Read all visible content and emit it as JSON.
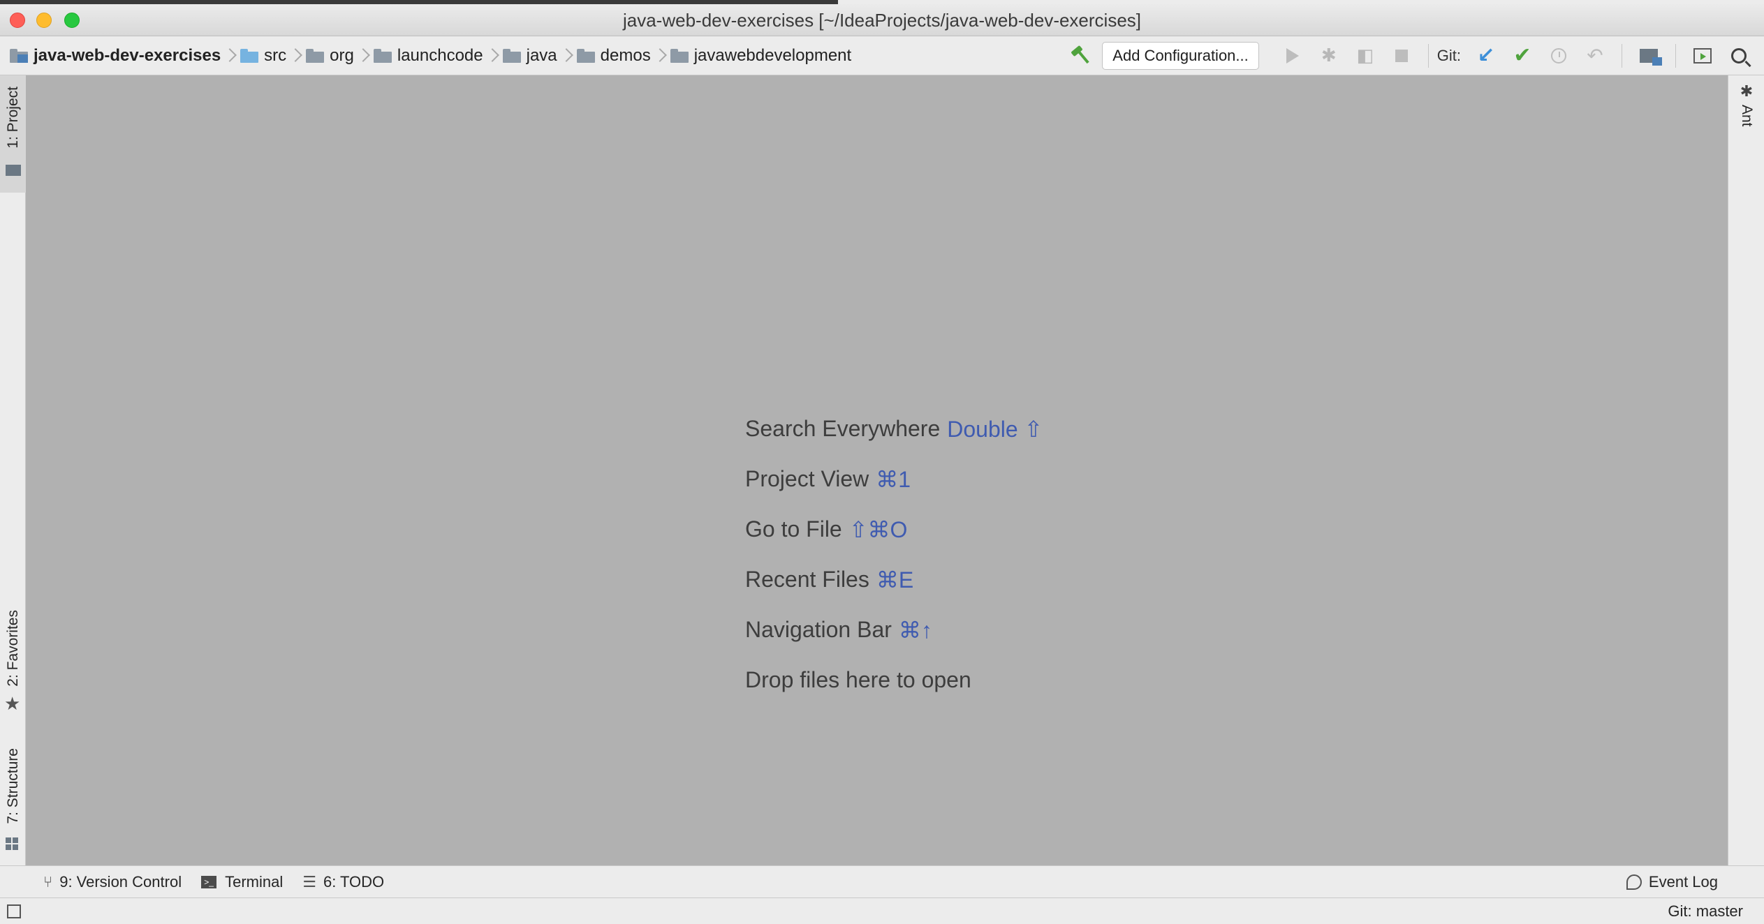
{
  "window": {
    "title": "java-web-dev-exercises [~/IdeaProjects/java-web-dev-exercises]"
  },
  "breadcrumbs": [
    {
      "label": "java-web-dev-exercises",
      "icon": "project-folder-icon"
    },
    {
      "label": "src",
      "icon": "source-folder-icon"
    },
    {
      "label": "org",
      "icon": "folder-icon"
    },
    {
      "label": "launchcode",
      "icon": "folder-icon"
    },
    {
      "label": "java",
      "icon": "folder-icon"
    },
    {
      "label": "demos",
      "icon": "folder-icon"
    },
    {
      "label": "javawebdevelopment",
      "icon": "folder-icon"
    }
  ],
  "toolbar": {
    "add_configuration_label": "Add Configuration...",
    "git_label": "Git:"
  },
  "left_tools": {
    "project": "1: Project",
    "favorites": "2: Favorites",
    "structure": "7: Structure"
  },
  "right_tools": {
    "ant": "Ant"
  },
  "editor_hints": [
    {
      "label": "Search Everywhere",
      "shortcut": "Double ⇧"
    },
    {
      "label": "Project View",
      "shortcut": "⌘1"
    },
    {
      "label": "Go to File",
      "shortcut": "⇧⌘O"
    },
    {
      "label": "Recent Files",
      "shortcut": "⌘E"
    },
    {
      "label": "Navigation Bar",
      "shortcut": "⌘↑"
    },
    {
      "label": "Drop files here to open",
      "shortcut": ""
    }
  ],
  "bottom_tools": {
    "version_control": "9: Version Control",
    "terminal": "Terminal",
    "todo": "6: TODO",
    "event_log": "Event Log"
  },
  "status_bar": {
    "git_branch": "Git: master"
  },
  "colors": {
    "editor_bg": "#b1b1b1",
    "shortcut_accent": "#3f5bb0",
    "git_update": "#3d8fd8",
    "git_commit": "#4fa33d"
  }
}
